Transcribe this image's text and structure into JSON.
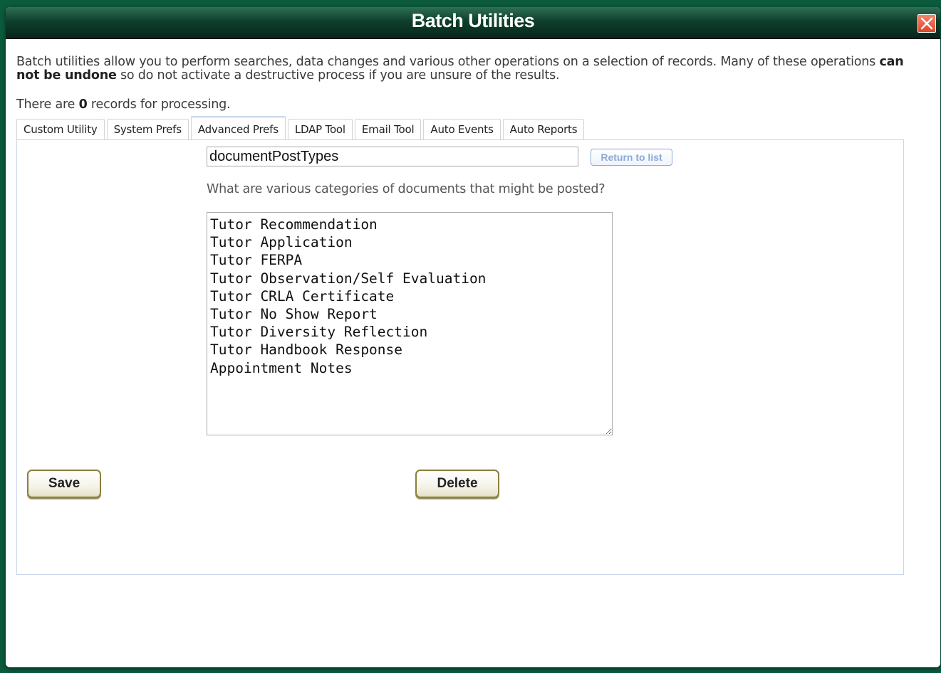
{
  "dialog": {
    "title": "Batch Utilities",
    "close_icon": "close-icon"
  },
  "intro": {
    "text_before": "Batch utilities allow you to perform searches, data changes and various other operations on a selection of records. Many of these operations ",
    "text_bold": "can not be undone",
    "text_after": " so do not activate a destructive process if you are unsure of the results."
  },
  "records": {
    "prefix": "There are ",
    "count": "0",
    "suffix": " records for processing."
  },
  "tabs": [
    {
      "label": "Custom Utility",
      "active": false
    },
    {
      "label": "System Prefs",
      "active": false
    },
    {
      "label": "Advanced Prefs",
      "active": true
    },
    {
      "label": "LDAP Tool",
      "active": false
    },
    {
      "label": "Email Tool",
      "active": false
    },
    {
      "label": "Auto Events",
      "active": false
    },
    {
      "label": "Auto Reports",
      "active": false
    }
  ],
  "pref": {
    "name": "documentPostTypes",
    "return_label": "Return to list",
    "description": "What are various categories of documents that might be posted?",
    "values": [
      "Tutor Recommendation",
      "Tutor Application",
      "Tutor FERPA",
      "Tutor Observation/Self Evaluation",
      "Tutor CRLA Certificate",
      "Tutor No Show Report",
      "Tutor Diversity Reflection",
      "Tutor Handbook Response",
      "Appointment Notes"
    ]
  },
  "actions": {
    "save_label": "Save",
    "delete_label": "Delete"
  },
  "colors": {
    "backdrop": "#0b5a3c",
    "titlebar": "#0f3f2c",
    "close": "#e0452a",
    "tab_active_border": "#c7d6e8",
    "button_border": "#8a7f3c",
    "return_text": "#8aa9d6"
  }
}
